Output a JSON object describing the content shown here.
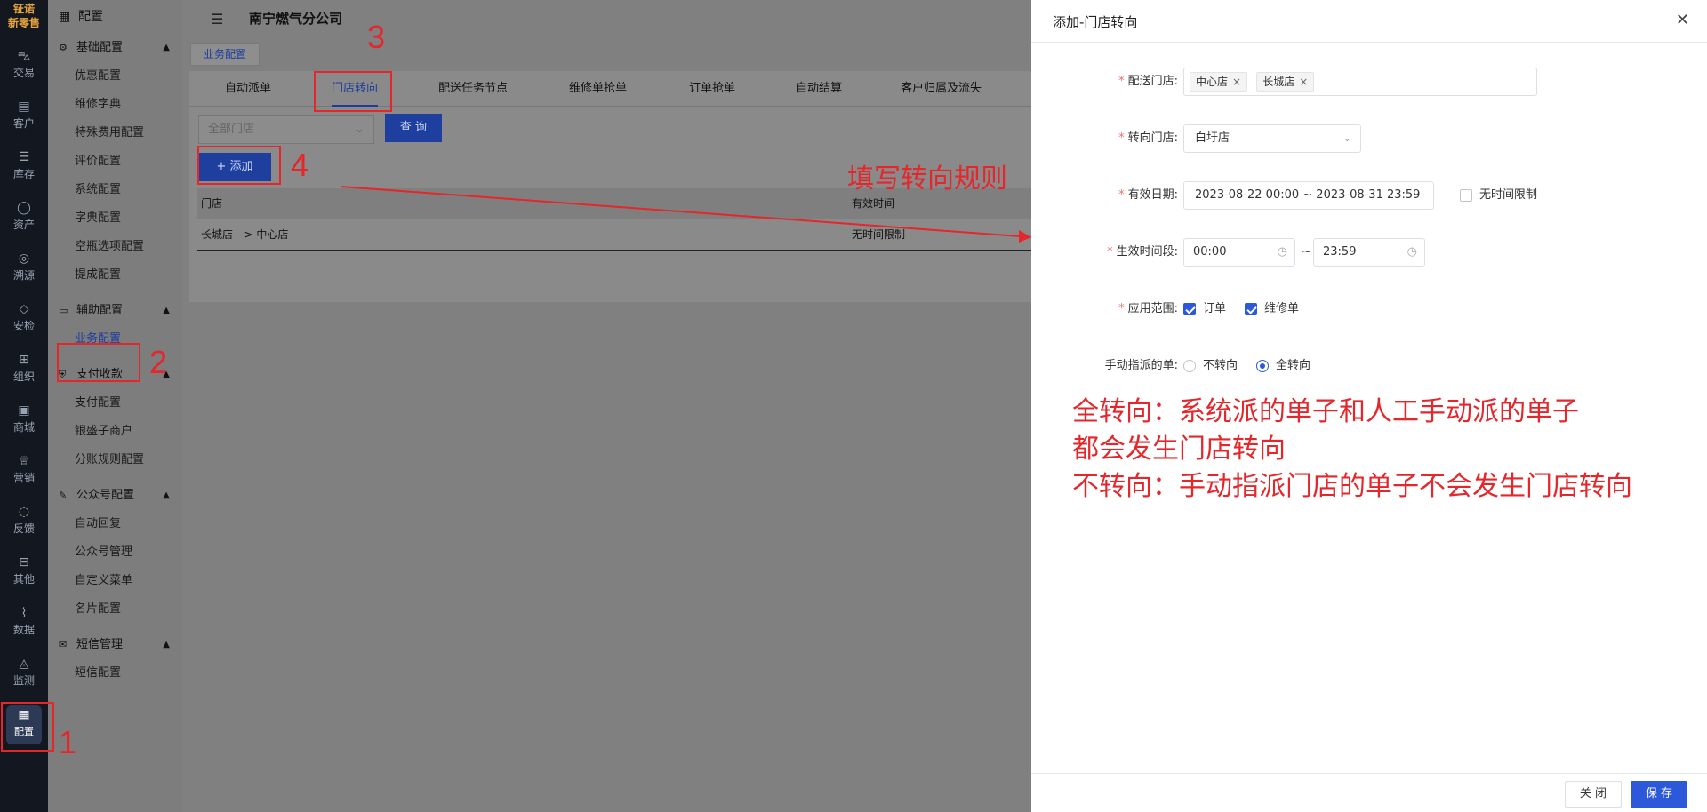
{
  "logo": {
    "line1": "钲诺",
    "line2": "新零售"
  },
  "rail": [
    {
      "label": "交易",
      "icon": "bag-icon"
    },
    {
      "label": "客户",
      "icon": "id-card-icon"
    },
    {
      "label": "库存",
      "icon": "list-icon"
    },
    {
      "label": "资产",
      "icon": "bulb-icon"
    },
    {
      "label": "溯源",
      "icon": "compass-icon"
    },
    {
      "label": "安检",
      "icon": "shield-icon"
    },
    {
      "label": "组织",
      "icon": "org-icon"
    },
    {
      "label": "商城",
      "icon": "store-icon"
    },
    {
      "label": "营销",
      "icon": "trophy-icon"
    },
    {
      "label": "反馈",
      "icon": "chat-icon"
    },
    {
      "label": "其他",
      "icon": "apps-icon"
    },
    {
      "label": "数据",
      "icon": "chart-icon"
    },
    {
      "label": "监测",
      "icon": "alarm-icon"
    },
    {
      "label": "配置",
      "icon": "grid-icon"
    }
  ],
  "menu": {
    "title": "配置",
    "groups": [
      {
        "title": "基础配置",
        "items": [
          "优惠配置",
          "维修字典",
          "特殊费用配置",
          "评价配置",
          "系统配置",
          "字典配置",
          "空瓶选项配置",
          "提成配置"
        ]
      },
      {
        "title": "辅助配置",
        "items": [
          "业务配置"
        ]
      },
      {
        "title": "支付收款",
        "items": [
          "支付配置",
          "银盛子商户",
          "分账规则配置"
        ]
      },
      {
        "title": "公众号配置",
        "items": [
          "自动回复",
          "公众号管理",
          "自定义菜单",
          "名片配置"
        ]
      },
      {
        "title": "短信管理",
        "items": [
          "短信配置"
        ]
      }
    ]
  },
  "header": {
    "company": "南宁燃气分公司"
  },
  "breadcrumb_tag": "业务配置",
  "tabs": [
    "自动派单",
    "门店转向",
    "配送任务节点",
    "维修单抢单",
    "订单抢单",
    "自动结算",
    "客户归属及流失"
  ],
  "filter": {
    "placeholder": "全部门店",
    "query_label": "查 询",
    "add_label": "+  添加"
  },
  "table": {
    "headers": [
      "门店",
      "有效时间"
    ],
    "rows": [
      [
        "长城店 --> 中心店",
        "无时间限制"
      ]
    ]
  },
  "annotations": {
    "n1": "1",
    "n2": "2",
    "n3": "3",
    "n4": "4",
    "rule": "填写转向规则",
    "note1": "全转向：系统派的单子和人工手动派的单子",
    "note2": "都会发生门店转向",
    "note3": "不转向：手动指派门店的单子不会发生门店转向"
  },
  "drawer": {
    "title": "添加-门店转向",
    "delivery_label": "配送门店:",
    "delivery_tags": [
      "中心店",
      "长城店"
    ],
    "redirect_label": "转向门店:",
    "redirect_value": "白圩店",
    "date_label": "有效日期:",
    "date_value": "2023-08-22 00:00 ~ 2023-08-31 23:59",
    "no_limit_label": "无时间限制",
    "period_label": "生效时间段:",
    "period_start": "00:00",
    "period_sep": "~",
    "period_end": "23:59",
    "scope_label": "应用范围:",
    "scope_options": [
      "订单",
      "维修单"
    ],
    "manual_label": "手动指派的单:",
    "manual_options": [
      "不转向",
      "全转向"
    ],
    "manual_selected": "全转向",
    "close_label": "关 闭",
    "save_label": "保 存"
  },
  "colors": {
    "primary": "#2b59d9",
    "annotation": "#e5262b",
    "rail_bg": "#13171f"
  }
}
